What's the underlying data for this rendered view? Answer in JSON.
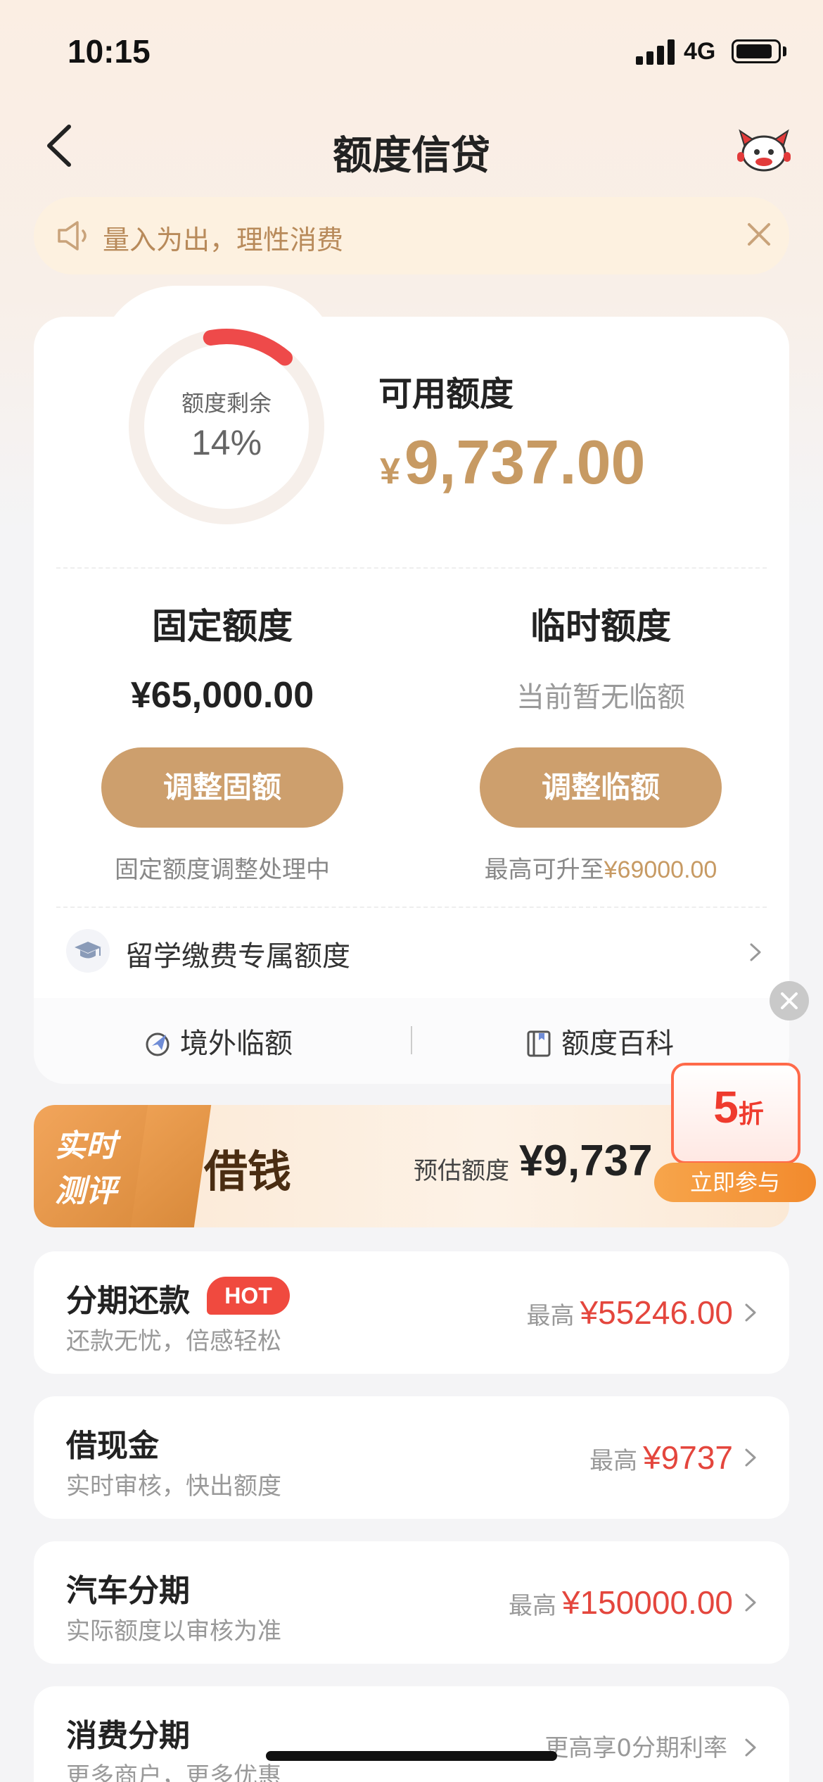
{
  "status_bar": {
    "time": "10:15",
    "network": "4G"
  },
  "nav": {
    "title": "额度信贷"
  },
  "notice": {
    "text": "量入为出，理性消费"
  },
  "credit": {
    "ring_label": "额度剩余",
    "ring_percent": "14%",
    "ring_fraction": 0.14,
    "available_label": "可用额度",
    "available_currency": "¥",
    "available_amount": "9,737.00",
    "fixed": {
      "title": "固定额度",
      "value": "¥65,000.00",
      "button": "调整固额",
      "note": "固定额度调整处理中"
    },
    "temporary": {
      "title": "临时额度",
      "value": "当前暂无临额",
      "button": "调整临额",
      "note_prefix": "最高可升至",
      "note_amount": "¥69000.00"
    },
    "study_label": "留学缴费专属额度",
    "footer": {
      "overseas": "境外临额",
      "wiki": "额度百科"
    }
  },
  "banner": {
    "badge_line1": "实时",
    "badge_line2": "测评",
    "title": "借钱",
    "est_label": "预估额度",
    "est_value": "¥9,737"
  },
  "promo": {
    "big": "5",
    "small": "折",
    "button": "立即参与"
  },
  "products": [
    {
      "title": "分期还款",
      "badge": "HOT",
      "subtitle": "还款无忧，倍感轻松",
      "prefix": "最高",
      "amount": "¥55246.00"
    },
    {
      "title": "借现金",
      "subtitle": "实时审核，快出额度",
      "prefix": "最高",
      "amount": "¥9737"
    },
    {
      "title": "汽车分期",
      "subtitle": "实际额度以审核为准",
      "prefix": "最高",
      "amount": "¥150000.00"
    },
    {
      "title": "消费分期",
      "subtitle": "更多商户，更多优惠",
      "prefix": "更高享0分期利率",
      "amount": ""
    }
  ],
  "colors": {
    "accent_gold": "#c79a63",
    "button_gold": "#cd9f6d",
    "red": "#e4463d",
    "ring_red": "#ee4a4a"
  }
}
